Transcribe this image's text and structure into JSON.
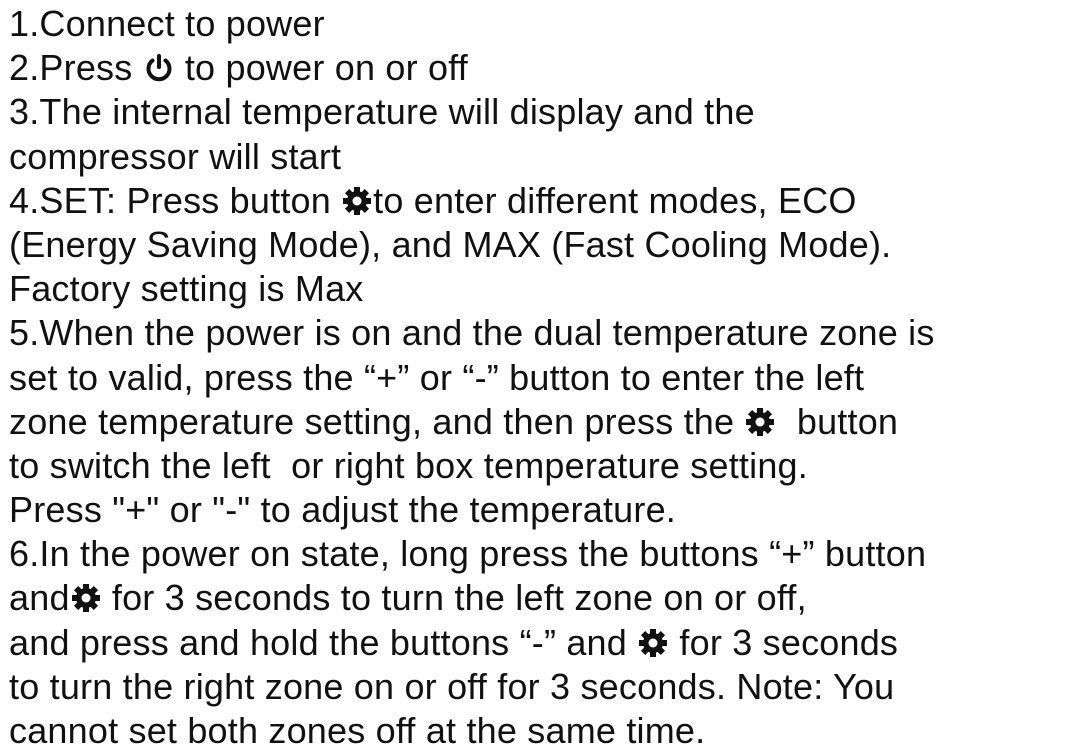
{
  "instructions": {
    "l1": "1.Connect to power",
    "l2a": "2.Press ",
    "l2b": " to power on or off",
    "l3": "3.The internal temperature will display and the",
    "l4": "compressor will start",
    "l5a": "4.SET: Press button ",
    "l5b": "to enter different modes, ECO",
    "l6": "(Energy Saving Mode), and MAX (Fast Cooling Mode).",
    "l7": "Factory setting is Max",
    "l8": "5.When the power is on and the dual temperature zone is",
    "l9": "set to valid, press the “+” or “-” button to enter the left",
    "l10a": "zone temperature setting, and then press the ",
    "l10b": "  button",
    "l11": "to switch the left  or right box temperature setting.",
    "l12": "Press \"+\" or \"-\" to adjust the temperature.",
    "l13": "6.In the power on state, long press the buttons “+” button",
    "l14a": "and",
    "l14b": " for 3 seconds to turn the left zone on or off,",
    "l15a": "and press and hold the buttons “-” and ",
    "l15b": " for 3 seconds",
    "l16": "to turn the right zone on or off for 3 seconds. Note: You",
    "l17": "cannot set both zones off at the same time."
  },
  "icons": {
    "power": "power-icon",
    "settings": "gear-icon"
  }
}
